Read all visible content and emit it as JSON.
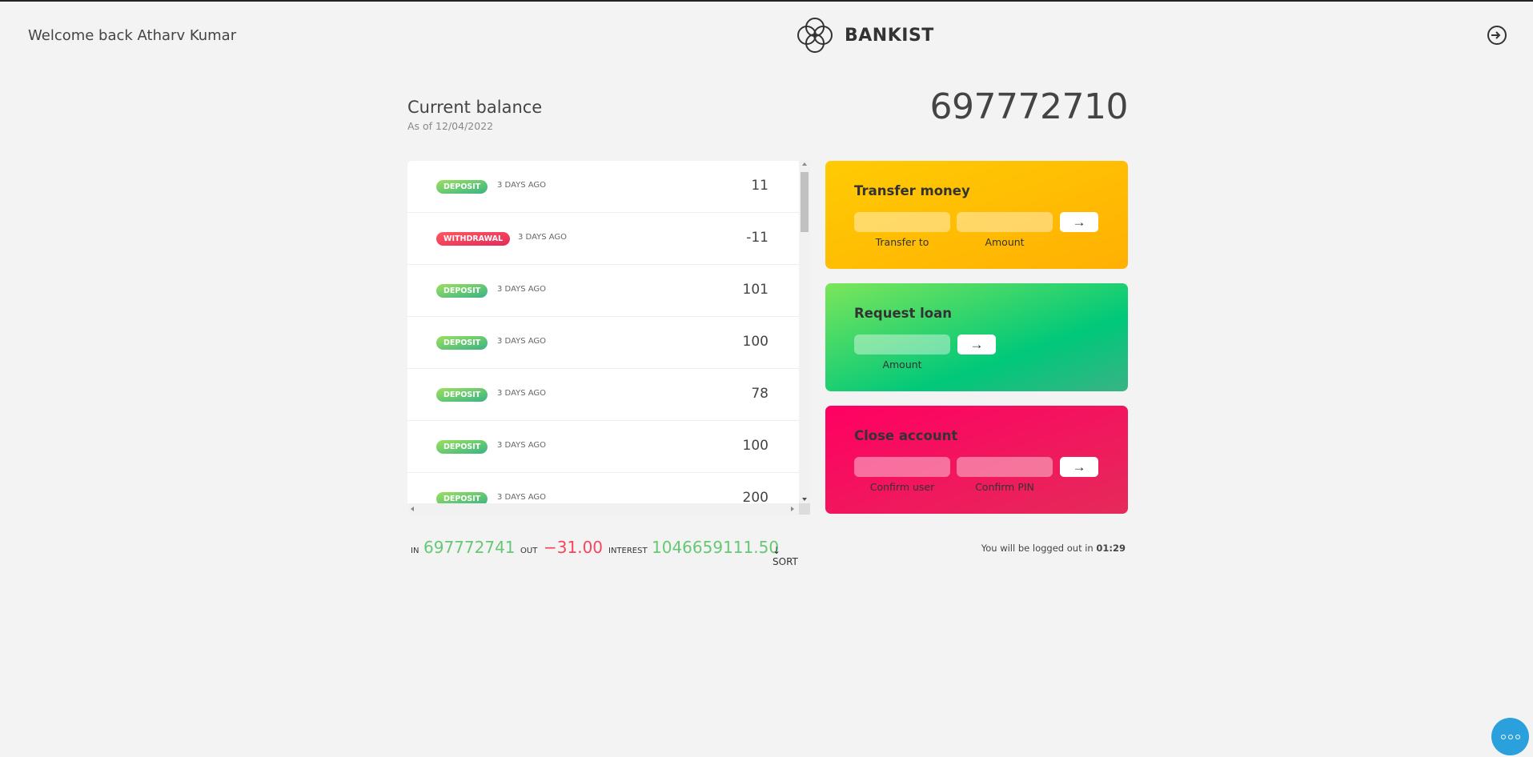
{
  "nav": {
    "welcome": "Welcome back Atharv Kumar",
    "logo_text": "BANKIST",
    "logout_icon": "logout-icon"
  },
  "balance": {
    "label": "Current balance",
    "date": "As of 12/04/2022",
    "value": "697772710"
  },
  "movements": [
    {
      "type": "deposit",
      "type_label": "DEPOSIT",
      "date": "3 DAYS AGO",
      "value": "11"
    },
    {
      "type": "withdrawal",
      "type_label": "WITHDRAWAL",
      "date": "3 DAYS AGO",
      "value": "-11"
    },
    {
      "type": "deposit",
      "type_label": "DEPOSIT",
      "date": "3 DAYS AGO",
      "value": "101"
    },
    {
      "type": "deposit",
      "type_label": "DEPOSIT",
      "date": "3 DAYS AGO",
      "value": "100"
    },
    {
      "type": "deposit",
      "type_label": "DEPOSIT",
      "date": "3 DAYS AGO",
      "value": "78"
    },
    {
      "type": "deposit",
      "type_label": "DEPOSIT",
      "date": "3 DAYS AGO",
      "value": "100"
    },
    {
      "type": "deposit",
      "type_label": "DEPOSIT",
      "date": "3 DAYS AGO",
      "value": "200"
    }
  ],
  "operations": {
    "transfer": {
      "title": "Transfer money",
      "to_label": "Transfer to",
      "amount_label": "Amount",
      "button": "→"
    },
    "loan": {
      "title": "Request loan",
      "amount_label": "Amount",
      "button": "→"
    },
    "close": {
      "title": "Close account",
      "user_label": "Confirm user",
      "pin_label": "Confirm PIN",
      "button": "→"
    }
  },
  "summary": {
    "in_label": "In",
    "in_value": "697772741",
    "out_label": "Out",
    "out_value": "−31.00",
    "interest_label": "Interest",
    "interest_value": "1046659111.50",
    "sort_label": "↓ SORT"
  },
  "logout_timer": {
    "text": "You will be logged out in ",
    "time": "01:29"
  },
  "colors": {
    "deposit": "#39b385",
    "withdrawal": "#e52a5a",
    "transfer": "#ffb003",
    "loan": "#39b385",
    "close": "#ff0062",
    "fab": "#2aa0dd"
  }
}
